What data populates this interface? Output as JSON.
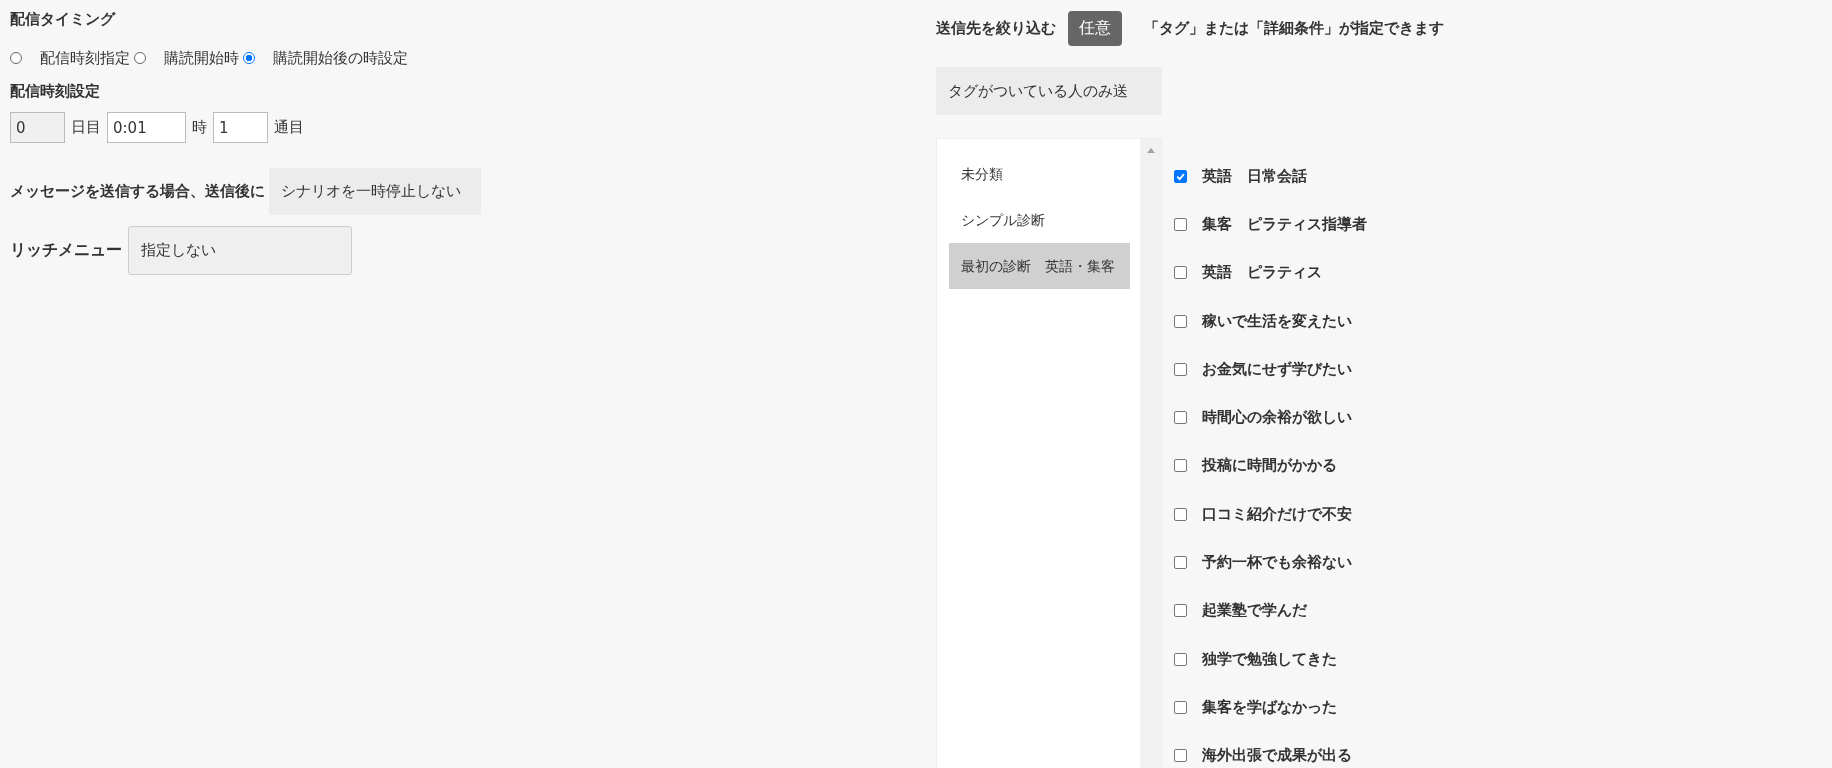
{
  "timing": {
    "title": "配信タイミング",
    "options": [
      {
        "label": "配信時刻指定",
        "selected": false
      },
      {
        "label": "購読開始時",
        "selected": false
      },
      {
        "label": "購読開始後の時設定",
        "selected": true
      }
    ]
  },
  "time_setting": {
    "title": "配信時刻設定",
    "day_value": "0",
    "day_label": "日目",
    "time_value": "0:01",
    "time_label": "時",
    "count_value": "1",
    "count_label": "通目"
  },
  "pause": {
    "label": "メッセージを送信する場合、送信後に",
    "value": "シナリオを一時停止しない"
  },
  "rich_menu": {
    "label": "リッチメニュー",
    "value": "指定しない"
  },
  "filter": {
    "title": "送信先を絞り込む",
    "badge": "任意",
    "note": "「タグ」または「詳細条件」が指定できます",
    "mode": "タグがついている人のみ送"
  },
  "categories": [
    {
      "label": "未分類",
      "selected": false
    },
    {
      "label": "シンプル診断",
      "selected": false
    },
    {
      "label": "最初の診断　英語・集客",
      "selected": true
    }
  ],
  "tags": [
    {
      "label": "英語　日常会話",
      "checked": true
    },
    {
      "label": "集客　ピラティス指導者",
      "checked": false
    },
    {
      "label": "英語　ピラティス",
      "checked": false
    },
    {
      "label": "稼いで生活を変えたい",
      "checked": false
    },
    {
      "label": "お金気にせず学びたい",
      "checked": false
    },
    {
      "label": "時間心の余裕が欲しい",
      "checked": false
    },
    {
      "label": "投稿に時間がかかる",
      "checked": false
    },
    {
      "label": "口コミ紹介だけで不安",
      "checked": false
    },
    {
      "label": "予約一杯でも余裕ない",
      "checked": false
    },
    {
      "label": "起業塾で学んだ",
      "checked": false
    },
    {
      "label": "独学で勉強してきた",
      "checked": false
    },
    {
      "label": "集客を学ばなかった",
      "checked": false
    },
    {
      "label": "海外出張で成果が出る",
      "checked": false
    }
  ]
}
